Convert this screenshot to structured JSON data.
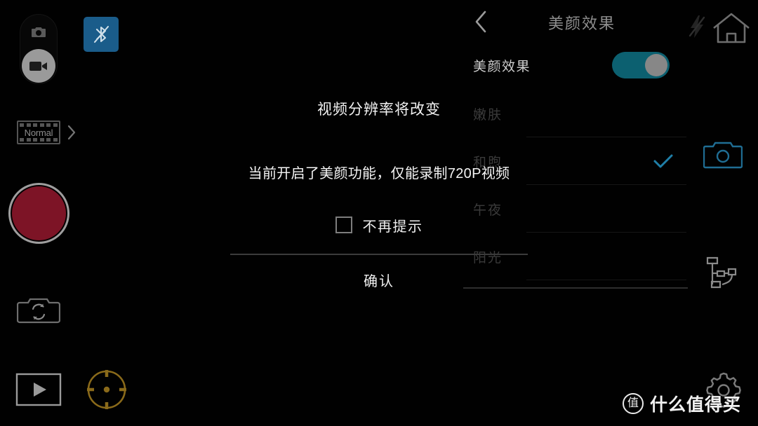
{
  "app": {
    "background_color": "#000000",
    "accent_teal": "#0c6070",
    "accent_blue": "#1a5c8a",
    "record_red": "#7d1426",
    "reticle_amber": "#8a6a1a"
  },
  "left_rail": {
    "mode_toggle": {
      "photo_icon": "camera-icon",
      "video_icon": "video-camera-icon",
      "selected": "video"
    },
    "bluetooth": {
      "icon": "bluetooth-off-icon",
      "state": "off",
      "background": "#1a5c8a"
    },
    "mode_selector": {
      "icon": "film-strip-icon",
      "label": "Normal",
      "chevron": "chevron-right-icon"
    },
    "record_button": {
      "name": "record-button",
      "color": "#7d1426"
    },
    "camera_switch_icon": "camera-switch-icon",
    "playback_icon": "play-button-icon",
    "focus_reticle_icon": "focus-reticle-icon"
  },
  "dialog": {
    "title": "视频分辨率将改变",
    "message": "当前开启了美颜功能，仅能录制720P视频",
    "checkbox_label": "不再提示",
    "checkbox_checked": false,
    "confirm_label": "确认"
  },
  "settings_panel": {
    "back_icon": "chevron-left-icon",
    "title": "美颜效果",
    "toggle_row": {
      "label": "美颜效果",
      "enabled": true
    },
    "options": [
      {
        "label": "嫩肤",
        "selected": false
      },
      {
        "label": "和煦",
        "selected": true
      },
      {
        "label": "午夜",
        "selected": false
      },
      {
        "label": "阳光",
        "selected": false
      }
    ],
    "selected_check_icon": "check-icon"
  },
  "right_rail": {
    "flash_icon": "flash-off-icon",
    "home_icon": "home-icon",
    "camera_icon": "camera-outline-icon",
    "transfer_icon": "device-transfer-icon",
    "settings_icon": "gear-icon"
  },
  "watermark": {
    "logo_char": "值",
    "text": "什么值得买"
  }
}
